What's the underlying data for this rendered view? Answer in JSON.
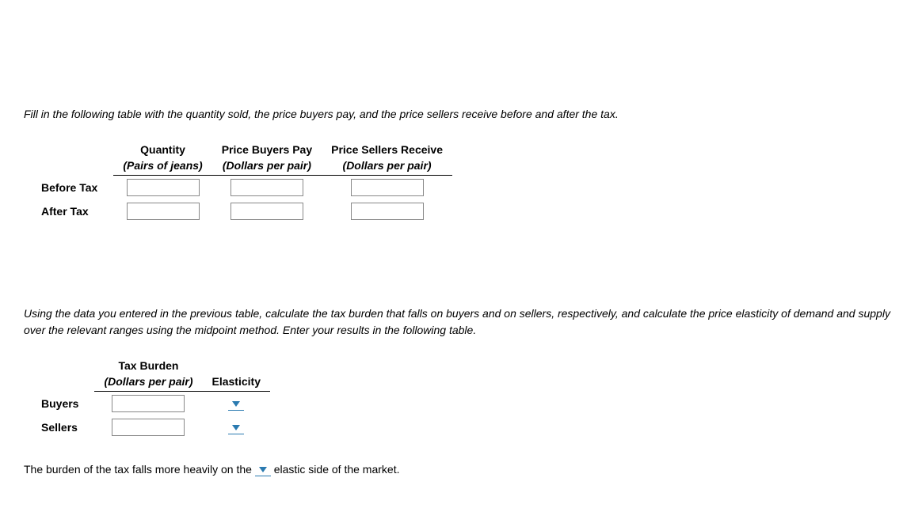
{
  "instruction1": "Fill in the following table with the quantity sold, the price buyers pay, and the price sellers receive before and after the tax.",
  "table1": {
    "headers": {
      "col1": {
        "main": "Quantity",
        "sub": "(Pairs of jeans)"
      },
      "col2": {
        "main": "Price Buyers Pay",
        "sub": "(Dollars per pair)"
      },
      "col3": {
        "main": "Price Sellers Receive",
        "sub": "(Dollars per pair)"
      }
    },
    "rows": {
      "r1": "Before Tax",
      "r2": "After Tax"
    }
  },
  "instruction2": "Using the data you entered in the previous table, calculate the tax burden that falls on buyers and on sellers, respectively, and calculate the price elasticity of demand and supply over the relevant ranges using the midpoint method. Enter your results in the following table.",
  "table2": {
    "headers": {
      "col1": {
        "main": "Tax Burden",
        "sub": "(Dollars per pair)"
      },
      "col2": {
        "main": "Elasticity"
      }
    },
    "rows": {
      "r1": "Buyers",
      "r2": "Sellers"
    }
  },
  "final": {
    "pre": "The burden of the tax falls more heavily on the ",
    "post": " elastic side of the market."
  }
}
